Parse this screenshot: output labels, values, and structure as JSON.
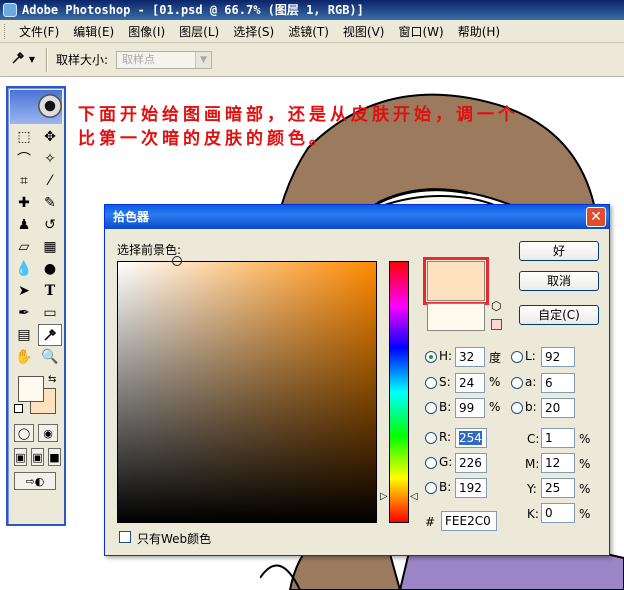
{
  "window": {
    "title": "Adobe Photoshop - [01.psd @ 66.7% (图层 1, RGB)]"
  },
  "menu": [
    "文件(F)",
    "编辑(E)",
    "图像(I)",
    "图层(L)",
    "选择(S)",
    "滤镜(T)",
    "视图(V)",
    "窗口(W)",
    "帮助(H)"
  ],
  "options": {
    "tool_icon": "eyedropper-icon",
    "sample_size_label": "取样大小:",
    "sample_size_value": "取样点"
  },
  "instruction": {
    "line1": "下面开始给图画暗部，还是从皮肤开始，调一个",
    "line2": "比第一次暗的皮肤的颜色。"
  },
  "toolbox": {
    "foreground_color": "#fffaee",
    "background_color": "#fee2c0"
  },
  "color_picker": {
    "title": "拾色器",
    "select_label": "选择前景色:",
    "buttons": {
      "ok": "好",
      "cancel": "取消",
      "custom": "自定(C)"
    },
    "hsb": {
      "h": {
        "label": "H:",
        "value": "32",
        "unit": "度"
      },
      "s": {
        "label": "S:",
        "value": "24",
        "unit": "%"
      },
      "b": {
        "label": "B:",
        "value": "99",
        "unit": "%"
      }
    },
    "rgb": {
      "r": {
        "label": "R:",
        "value": "254"
      },
      "g": {
        "label": "G:",
        "value": "226"
      },
      "b": {
        "label": "B:",
        "value": "192"
      }
    },
    "lab": {
      "l": {
        "label": "L:",
        "value": "92"
      },
      "a": {
        "label": "a:",
        "value": "6"
      },
      "b": {
        "label": "b:",
        "value": "20"
      }
    },
    "cmyk": {
      "c": {
        "label": "C:",
        "value": "1",
        "unit": "%"
      },
      "m": {
        "label": "M:",
        "value": "12",
        "unit": "%"
      },
      "y": {
        "label": "Y:",
        "value": "25",
        "unit": "%"
      },
      "k": {
        "label": "K:",
        "value": "0",
        "unit": "%"
      }
    },
    "hex": {
      "label": "#",
      "value": "FEE2C0"
    },
    "web_only_label": "只有Web颜色",
    "new_color": "#fee2c0",
    "old_color": "#fffaee"
  }
}
